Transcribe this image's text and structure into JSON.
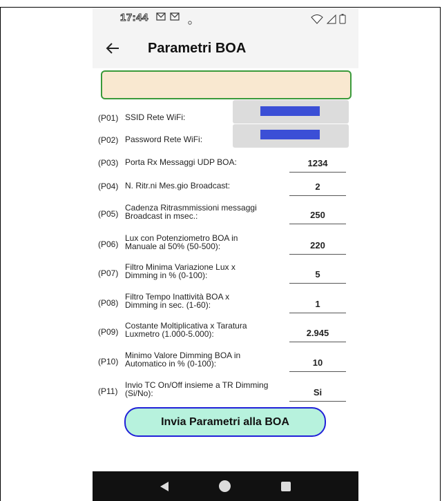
{
  "status_bar": {
    "time": "17:44",
    "notification_icons": [
      "mail-icon",
      "mail-icon",
      "dot-icon"
    ],
    "system_icons": [
      "wifi-icon",
      "signal-icon",
      "battery-icon"
    ]
  },
  "app_bar": {
    "back_icon": "arrow-left-icon",
    "title": "Parametri BOA"
  },
  "message_box": {
    "text": ""
  },
  "parameters": [
    {
      "code": "(P01)",
      "label": "SSID Rete WiFi:",
      "value": ""
    },
    {
      "code": "(P02)",
      "label": "Password Rete WiFi:",
      "value": ""
    },
    {
      "code": "(P03)",
      "label": "Porta Rx Messaggi UDP BOA:",
      "value": "1234"
    },
    {
      "code": "(P04)",
      "label": "N. Ritr.ni Mes.gio Broadcast:",
      "value": "2"
    },
    {
      "code": "(P05)",
      "label": "Cadenza Ritrasmmissioni messaggi Broadcast in msec.:",
      "value": "250"
    },
    {
      "code": "(P06)",
      "label": "Lux con Potenziometro BOA in Manuale al 50% (50-500):",
      "value": "220"
    },
    {
      "code": "(P07)",
      "label": "Filtro Minima Variazione Lux x Dimming in % (0-100):",
      "value": "5"
    },
    {
      "code": "(P08)",
      "label": "Filtro Tempo Inattività BOA x Dimming in sec. (1-60):",
      "value": "1"
    },
    {
      "code": "(P09)",
      "label": "Costante Moltiplicativa x Taratura Luxmetro (1.000-5.000):",
      "value": "2.945"
    },
    {
      "code": "(P10)",
      "label": "Minimo Valore Dimming BOA in Automatico in % (0-100):",
      "value": "10"
    },
    {
      "code": "(P11)",
      "label": "Invio TC On/Off insieme a TR Dimming (Si/No):",
      "value": "Si"
    }
  ],
  "send_button": {
    "label": "Invia Parametri alla BOA"
  },
  "nav_bar": {
    "icons": [
      "back-triangle-icon",
      "home-circle-icon",
      "recents-square-icon"
    ]
  },
  "colors": {
    "message_box_bg": "#f9e8d0",
    "message_box_border": "#3a9a3a",
    "button_bg": "#b7f2dd",
    "button_border": "#2020d8",
    "redaction_blue": "#3b4fd6"
  }
}
